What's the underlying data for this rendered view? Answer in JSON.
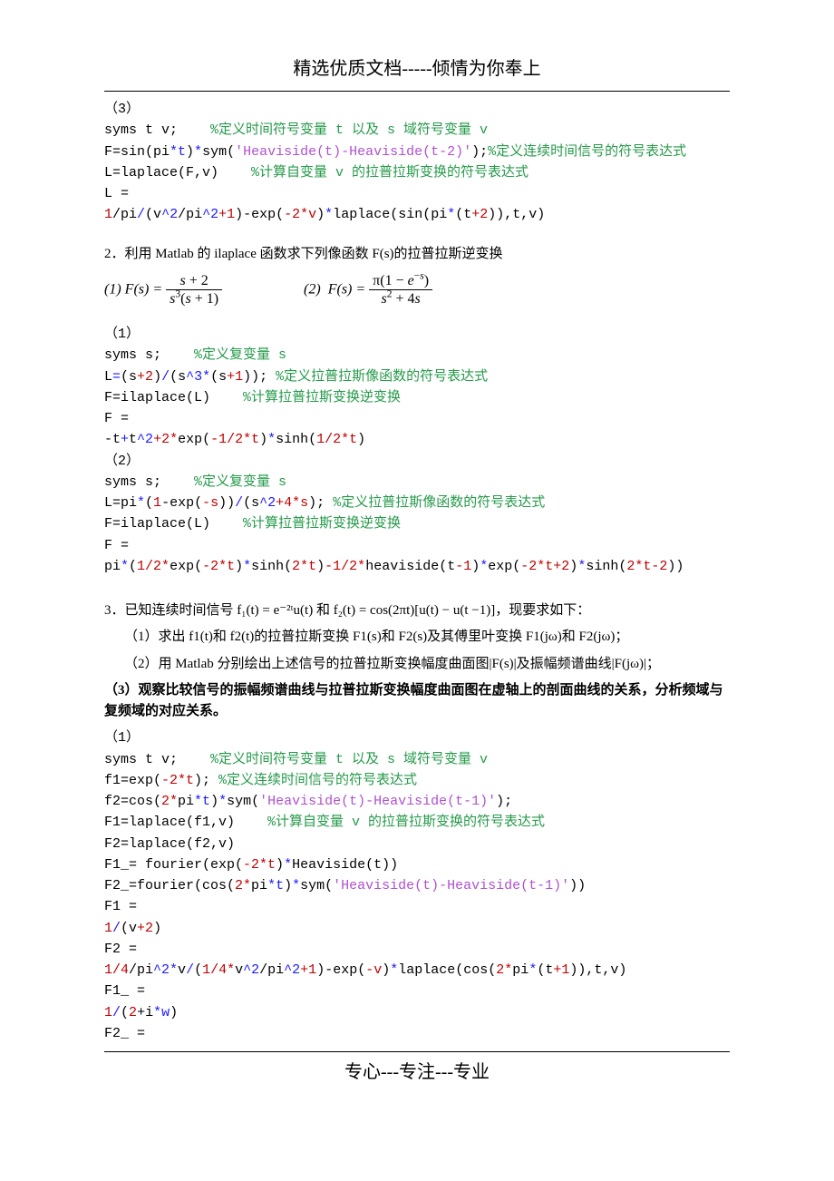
{
  "header": "精选优质文档-----倾情为你奉上",
  "footer": "专心---专注---专业",
  "b1": {
    "l1": "（3）",
    "l2a": "syms t v;    ",
    "l2b": "%定义时间符号变量 t 以及 s 域符号变量 v",
    "l3a": "F=sin(pi",
    "l3b": "*t",
    "l3c": ")",
    "l3d": "*",
    "l3e": "sym(",
    "l3f": "'Heaviside(t)-Heaviside(t-2)'",
    "l3g": ");",
    "l3h": "%定义连续时间信号的符号表达式",
    "l4a": "L=laplace(F,v)    ",
    "l4b": "%计算自变量 v 的拉普拉斯变换的符号表达式",
    "l5": "L =",
    "l6a": "1",
    "l6b": "/pi",
    "l6c": "/",
    "l6d": "(v",
    "l6e": "^2",
    "l6f": "/pi",
    "l6g": "^2",
    "l6h": "+1",
    "l6i": ")-exp(",
    "l6j": "-2*v",
    "l6k": ")",
    "l6l": "*",
    "l6m": "laplace(sin(pi",
    "l6n": "*",
    "l6o": "(t",
    "l6p": "+2",
    "l6q": ")),t,v)"
  },
  "q2": "2．利用 Matlab 的 ilaplace 函数求下列像函数 F(s)的拉普拉斯逆变换",
  "f2a": "(1) F(s) = (s+2) / (s³(s+1))",
  "f2b": "(2)  F(s) = π(1−e⁻ˢ) / (s²+4s)",
  "b2": {
    "l1": "（1）",
    "l2a": "syms s;    ",
    "l2b": "%定义复变量 s",
    "l3a": "L",
    "l3b": "=",
    "l3c": "(s",
    "l3d": "+2",
    "l3e": ")",
    "l3f": "/",
    "l3g": "(s",
    "l3h": "^3*",
    "l3i": "(s",
    "l3j": "+1",
    "l3k": ")); ",
    "l3l": "%定义拉普拉斯像函数的符号表达式",
    "l4a": "F=ilaplace(L)    ",
    "l4b": "%计算拉普拉斯变换逆变换",
    "l5": "F =",
    "l6a": "-t",
    "l6b": "+",
    "l6c": "t",
    "l6d": "^2",
    "l6e": "+2*",
    "l6f": "exp(",
    "l6g": "-1/2*t",
    "l6h": ")",
    "l6i": "*",
    "l6j": "sinh(",
    "l6k": "1/2*t",
    "l6l": ")",
    "l7": "（2）",
    "l8a": "syms s;    ",
    "l8b": "%定义复变量 s",
    "l9a": "L=pi",
    "l9b": "*",
    "l9c": "(",
    "l9d": "1",
    "l9e": "-exp(",
    "l9f": "-s",
    "l9g": "))",
    "l9h": "/",
    "l9i": "(s",
    "l9j": "^2",
    "l9k": "+4*s",
    "l9l": "); ",
    "l9m": "%定义拉普拉斯像函数的符号表达式",
    "l10a": "F=ilaplace(L)    ",
    "l10b": "%计算拉普拉斯变换逆变换",
    "l11": "F =",
    "l12a": "pi",
    "l12b": "*",
    "l12c": "(",
    "l12d": "1/2*",
    "l12e": "exp(",
    "l12f": "-2*t",
    "l12g": ")",
    "l12h": "*",
    "l12i": "sinh(",
    "l12j": "2*t",
    "l12k": ")",
    "l12l": "-1/2*",
    "l12m": "heaviside(t",
    "l12n": "-1",
    "l12o": ")",
    "l12p": "*",
    "l12q": "exp(",
    "l12r": "-2*t+2",
    "l12s": ")",
    "l12t": "*",
    "l12u": "sinh(",
    "l12v": "2*t-2",
    "l12w": "))"
  },
  "q3": "3．已知连续时间信号 f₁(t) = e⁻²ᵗu(t)  和 f₂(t) = cos(2πt)[u(t) − u(t −1)]，现要求如下：",
  "q3_1": "（1）求出 f1(t)和 f2(t)的拉普拉斯变换 F1(s)和 F2(s)及其傅里叶变换 F1(jω)和 F2(jω)；",
  "q3_2": "（2）用 Matlab 分别绘出上述信号的拉普拉斯变换幅度曲面图|F(s)|及振幅频谱曲线|F(jω)|；",
  "q3_3": "（3）观察比较信号的振幅频谱曲线与拉普拉斯变换幅度曲面图在虚轴上的剖面曲线的关系，分析频域与复频域的对应关系。",
  "b3": {
    "l0": "（1）",
    "l1a": "syms t v;    ",
    "l1b": "%定义时间符号变量 t 以及 s 域符号变量 v",
    "l2a": "f1=exp(",
    "l2b": "-2*t",
    "l2c": "); ",
    "l2d": "%定义连续时间信号的符号表达式",
    "l3a": "f2=cos(",
    "l3b": "2*",
    "l3c": "pi",
    "l3d": "*t",
    "l3e": ")",
    "l3f": "*",
    "l3g": "sym(",
    "l3h": "'Heaviside(t)-Heaviside(t-1)'",
    "l3i": ");",
    "l4a": "F1=laplace(f1,v)    ",
    "l4b": "%计算自变量 v 的拉普拉斯变换的符号表达式",
    "l5": "F2=laplace(f2,v)",
    "l6a": "F1_= fourier(exp(",
    "l6b": "-2*t",
    "l6c": ")",
    "l6d": "*",
    "l6e": "Heaviside(t))",
    "l7a": "F2_=fourier(cos(",
    "l7b": "2*",
    "l7c": "pi",
    "l7d": "*t",
    "l7e": ")",
    "l7f": "*",
    "l7g": "sym(",
    "l7h": "'Heaviside(t)-Heaviside(t-1)'",
    "l7i": "))",
    "l8": "F1 =",
    "l9a": "1",
    "l9b": "/",
    "l9c": "(v",
    "l9d": "+2",
    "l9e": ")",
    "l10": "F2 =",
    "l11a": "1/4",
    "l11b": "/pi",
    "l11c": "^2*",
    "l11d": "v",
    "l11e": "/",
    "l11f": "(",
    "l11g": "1/4*",
    "l11h": "v",
    "l11i": "^2",
    "l11j": "/pi",
    "l11k": "^2",
    "l11l": "+1",
    "l11m": ")-exp(",
    "l11n": "-v",
    "l11o": ")",
    "l11p": "*",
    "l11q": "laplace(cos(",
    "l11r": "2*",
    "l11s": "pi",
    "l11t": "*",
    "l11u": "(t",
    "l11v": "+1",
    "l11w": ")),t,v)",
    "l12": "F1_ =",
    "l13a": "1",
    "l13b": "/",
    "l13c": "(",
    "l13d": "2",
    "l13e": "+i",
    "l13f": "*w",
    "l13g": ")",
    "l14": "F2_ ="
  }
}
